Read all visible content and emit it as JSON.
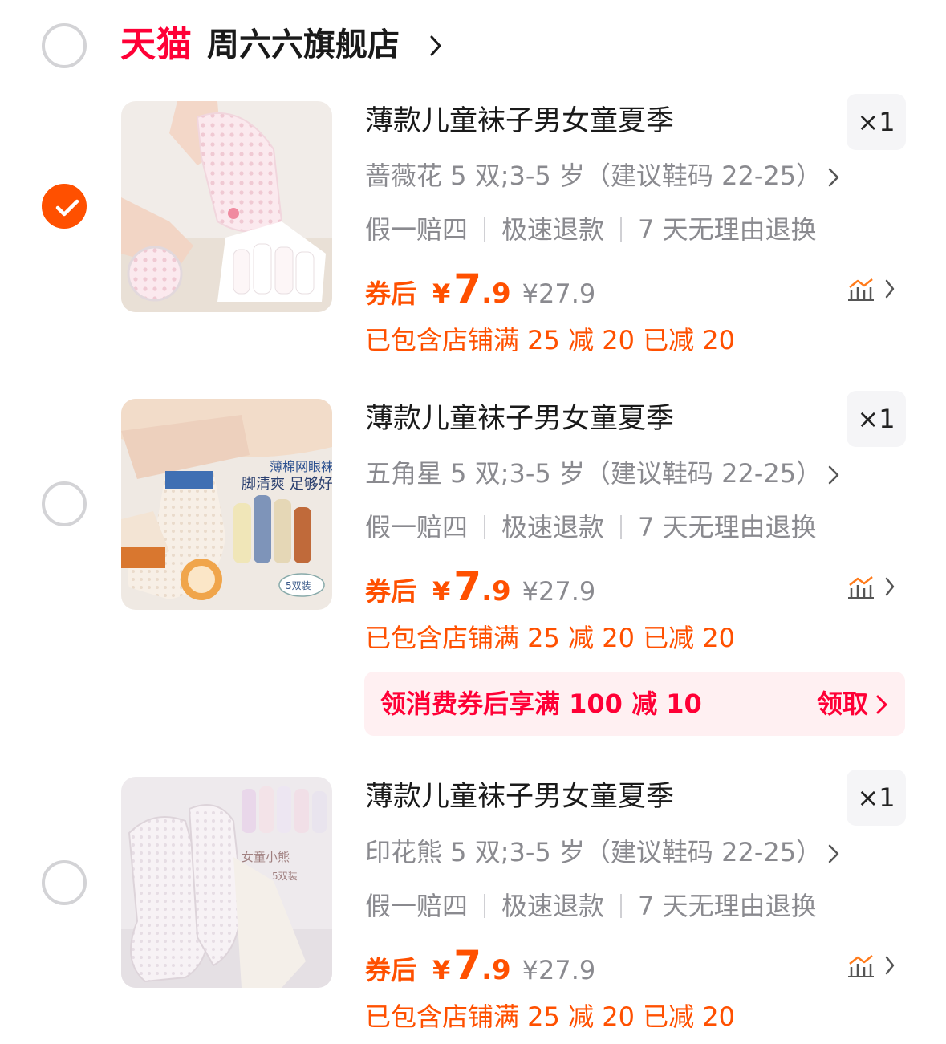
{
  "shop": {
    "badge": "天猫",
    "name": "周六六旗舰店",
    "selected": false
  },
  "items": [
    {
      "selected": true,
      "title": "薄款儿童袜子男女童夏季",
      "quantity": "×1",
      "sku": "蔷薇花 5 双;3-5 岁（建议鞋码 22-25）",
      "services": [
        "假一赔四",
        "极速退款",
        "7 天无理由退换"
      ],
      "price_label": "券后",
      "currency": "¥",
      "price_int": "7",
      "price_dec": ".9",
      "price_original": "¥27.9",
      "promo": "已包含店铺满 25 减 20 已减 20",
      "thumb_text": ""
    },
    {
      "selected": false,
      "title": "薄款儿童袜子男女童夏季",
      "quantity": "×1",
      "sku": "五角星 5 双;3-5 岁（建议鞋码 22-25）",
      "services": [
        "假一赔四",
        "极速退款",
        "7 天无理由退换"
      ],
      "price_label": "券后",
      "currency": "¥",
      "price_int": "7",
      "price_dec": ".9",
      "price_original": "¥27.9",
      "promo": "已包含店铺满 25 减 20 已减 20",
      "coupon": {
        "text": "领消费券后享满 100 减 10",
        "action": "领取"
      },
      "thumb_text": [
        "薄棉网眼袜",
        "脚清爽 足够好",
        "5双装"
      ]
    },
    {
      "selected": false,
      "title": "薄款儿童袜子男女童夏季",
      "quantity": "×1",
      "sku": "印花熊 5 双;3-5 岁（建议鞋码 22-25）",
      "services": [
        "假一赔四",
        "极速退款",
        "7 天无理由退换"
      ],
      "price_label": "券后",
      "currency": "¥",
      "price_int": "7",
      "price_dec": ".9",
      "price_original": "¥27.9",
      "promo": "已包含店铺满 25 减 20 已减 20",
      "thumb_text": [
        "女童小熊",
        "5双装"
      ]
    }
  ],
  "colors": {
    "accent": "#ff5000",
    "tmall_red": "#ff0036",
    "muted": "#8a8a8f"
  }
}
